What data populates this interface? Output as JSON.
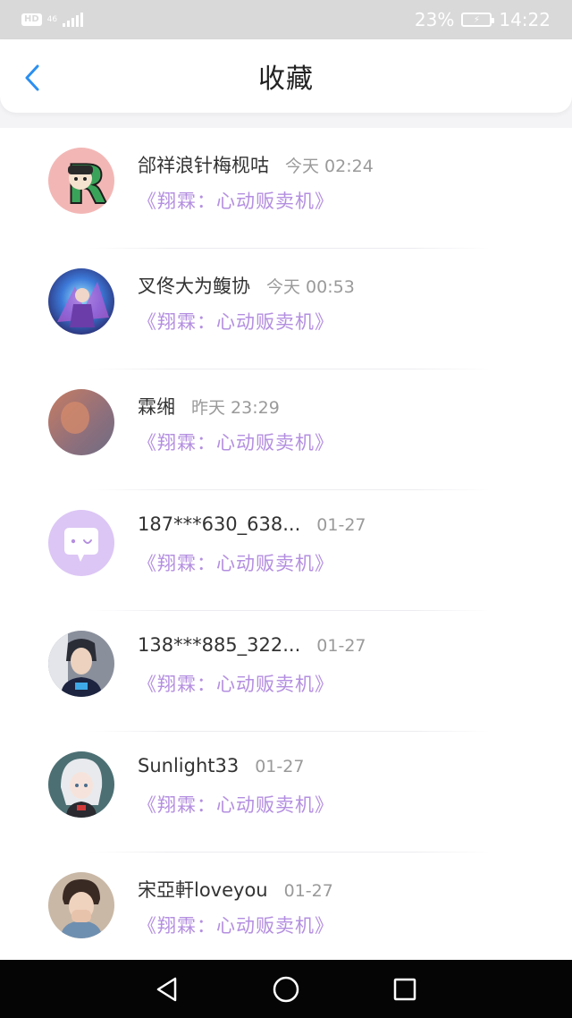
{
  "status_bar": {
    "hd": "HD",
    "network_top": "46",
    "network_bottom": "",
    "battery": "23%",
    "time": "14:22"
  },
  "header": {
    "title": "收藏",
    "back_icon": "chevron-left-icon"
  },
  "accent_color": "#2b8ff0",
  "work_color": "#b48fe0",
  "favorites": [
    {
      "name": "郃祥浪针梅枧咕",
      "time": "今天 02:24",
      "work": "《翔霖：心动贩卖机》",
      "avatar": "cartoon-letter-r"
    },
    {
      "name": "叉佟大为鳆协",
      "time": "今天 00:53",
      "work": "《翔霖：心动贩卖机》",
      "avatar": "game-character"
    },
    {
      "name": "霖缃",
      "time": "昨天 23:29",
      "work": "《翔霖：心动贩卖机》",
      "avatar": "blurred-photo"
    },
    {
      "name": "187***630_638...",
      "time": "01-27",
      "work": "《翔霖：心动贩卖机》",
      "avatar": "default-chat-bubble"
    },
    {
      "name": "138***885_322...",
      "time": "01-27",
      "work": "《翔霖：心动贩卖机》",
      "avatar": "boy-photo"
    },
    {
      "name": "Sunlight33",
      "time": "01-27",
      "work": "《翔霖：心动贩卖机》",
      "avatar": "anime-girl"
    },
    {
      "name": "宋亞軒loveyou",
      "time": "01-27",
      "work": "《翔霖：心动贩卖机》",
      "avatar": "boy-photo-2"
    }
  ],
  "nav_bar": {
    "back": "triangle-back-icon",
    "home": "circle-home-icon",
    "recents": "square-recents-icon"
  }
}
